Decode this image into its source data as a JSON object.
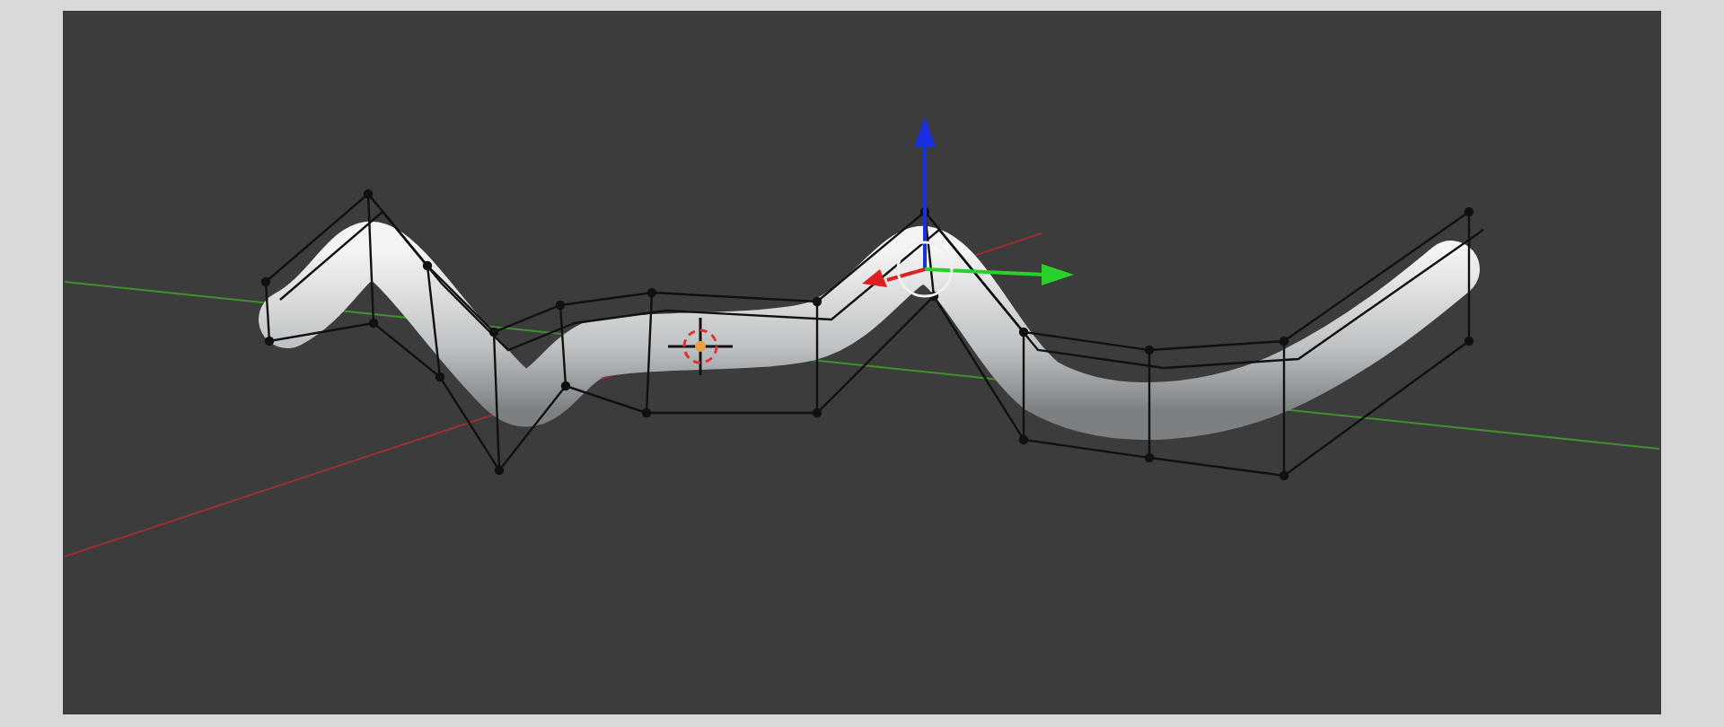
{
  "viewport": {
    "kind": "lattice"
  }
}
